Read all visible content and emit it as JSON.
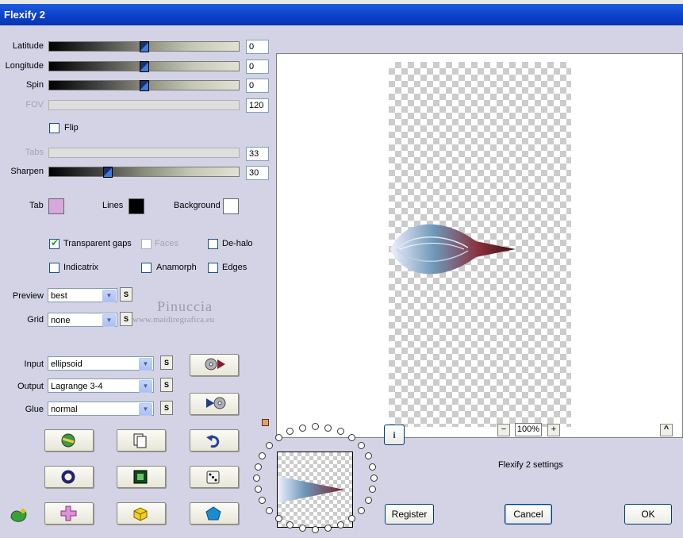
{
  "window": {
    "title": "Flexify 2"
  },
  "params": {
    "latitude": {
      "label": "Latitude",
      "value": "0",
      "level": 0.5
    },
    "longitude": {
      "label": "Longitude",
      "value": "0",
      "level": 0.5
    },
    "spin": {
      "label": "Spin",
      "value": "0",
      "level": 0.5
    },
    "fov": {
      "label": "FOV",
      "value": "120"
    },
    "flip": {
      "label": "Flip",
      "checked": false
    },
    "tabs": {
      "label": "Tabs",
      "value": "33"
    },
    "sharpen": {
      "label": "Sharpen",
      "value": "30",
      "level": 0.3
    }
  },
  "colors": {
    "tab": {
      "label": "Tab",
      "hex": "#d8a8dc"
    },
    "lines": {
      "label": "Lines",
      "hex": "#000000"
    },
    "background": {
      "label": "Background",
      "hex": "#ffffff"
    }
  },
  "options": {
    "transparent_gaps": {
      "label": "Transparent gaps",
      "checked": true
    },
    "faces": {
      "label": "Faces",
      "checked": false,
      "disabled": true
    },
    "de_halo": {
      "label": "De-halo",
      "checked": false
    },
    "indicatrix": {
      "label": "Indicatrix",
      "checked": false
    },
    "anamorph": {
      "label": "Anamorph",
      "checked": false
    },
    "edges": {
      "label": "Edges",
      "checked": false
    }
  },
  "preview_mode": {
    "label": "Preview",
    "value": "best"
  },
  "grid": {
    "label": "Grid",
    "value": "none"
  },
  "input": {
    "label": "Input",
    "value": "ellipsoid"
  },
  "output": {
    "label": "Output",
    "value": "Lagrange 3-4"
  },
  "glue": {
    "label": "Glue",
    "value": "normal"
  },
  "small_button_label": "S",
  "watermark": {
    "name": "Pinuccia",
    "url": "www.maidiregrafica.eu"
  },
  "zoom": {
    "value": "100%",
    "minus": "−",
    "plus": "+"
  },
  "settings_label": "Flexify 2 settings",
  "buttons": {
    "register": "Register",
    "cancel": "Cancel",
    "ok": "OK",
    "up": "^",
    "info": "i"
  }
}
